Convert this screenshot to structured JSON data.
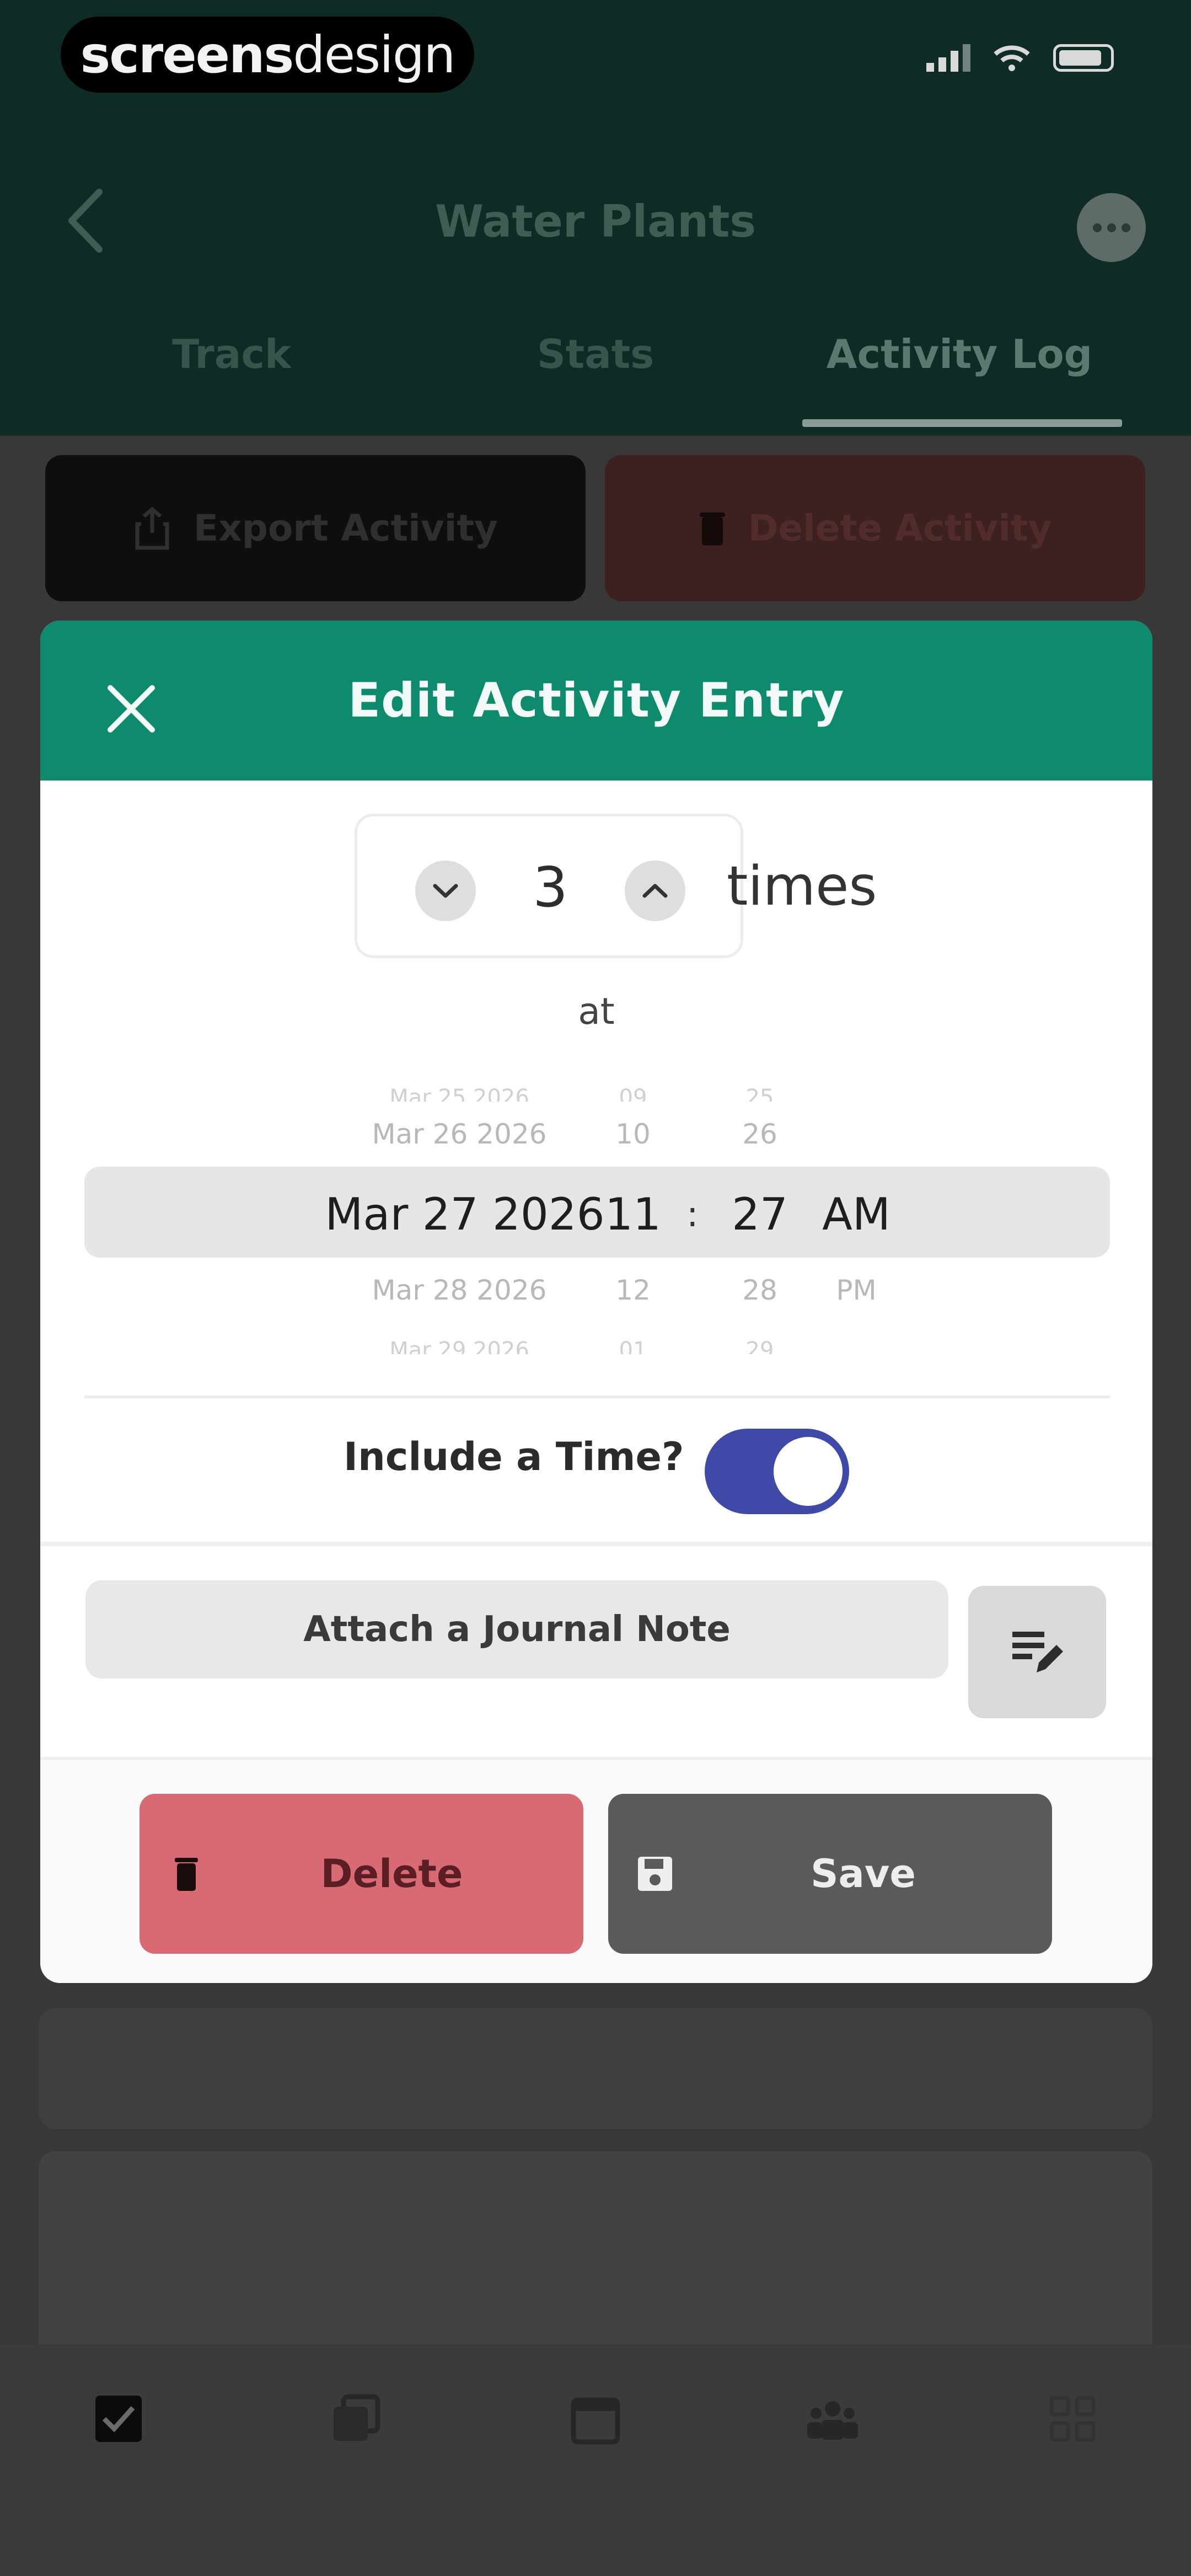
{
  "status_bar": {
    "brand_bold": "screens",
    "brand_thin": "design"
  },
  "header": {
    "title": "Water Plants"
  },
  "tabs": [
    {
      "label": "Track"
    },
    {
      "label": "Stats"
    },
    {
      "label": "Activity Log",
      "active": true
    }
  ],
  "actions": {
    "export_label": "Export Activity",
    "delete_label": "Delete Activity"
  },
  "modal": {
    "title": "Edit Activity Entry",
    "count": "3",
    "times_label": "times",
    "at_label": "at",
    "picker": {
      "dates": [
        "Mar 25 2026",
        "Mar 26 2026",
        "Mar 27 2026",
        "Mar 28 2026",
        "Mar 29 2026"
      ],
      "hours": [
        "09",
        "10",
        "11",
        "12",
        "01"
      ],
      "minutes": [
        "25",
        "26",
        "27",
        "28",
        "29"
      ],
      "ampm": [
        "AM",
        "PM"
      ],
      "colon": ":"
    },
    "include_time_label": "Include a Time?",
    "include_time_on": true,
    "journal_placeholder": "Attach a Journal Note",
    "delete_label": "Delete",
    "save_label": "Save"
  },
  "colors": {
    "accent": "#0e8a6c",
    "toggle": "#3f49a8",
    "delete": "#d86a74",
    "save": "#5a5a5a",
    "header_bg": "#0f2b25"
  }
}
